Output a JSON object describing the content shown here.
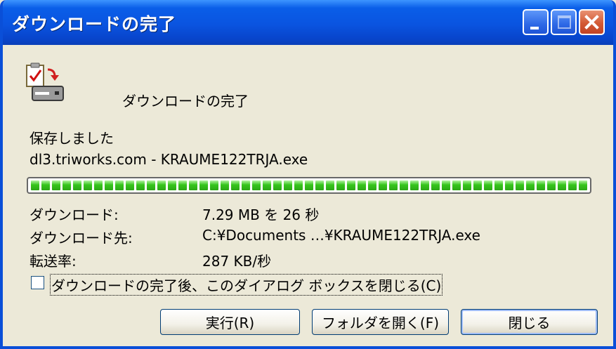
{
  "window": {
    "title": "ダウンロードの完了",
    "controls": {
      "minimize": "minimize",
      "maximize": "maximize",
      "close": "close"
    }
  },
  "dialog": {
    "heading": "ダウンロードの完了",
    "status": "保存しました",
    "file": "dl3.triworks.com - KRAUME122TRJA.exe",
    "progress": {
      "fraction": 1.0
    },
    "details": [
      {
        "label": "ダウンロード:",
        "value": "7.29 MB を 26 秒"
      },
      {
        "label": "ダウンロード先:",
        "value": "C:¥Documents …¥KRAUME122TRJA.exe"
      },
      {
        "label": "転送率:",
        "value": "287 KB/秒"
      }
    ],
    "close_when_done": {
      "label": "ダウンロードの完了後、このダイアログ ボックスを閉じる(C)",
      "checked": false
    },
    "buttons": {
      "run": "実行(R)",
      "open_folder": "フォルダを開く(F)",
      "close": "閉じる"
    }
  },
  "colors": {
    "titlebar": "#0a54e0",
    "face": "#ece9d8",
    "progress_fill": "#35c51c",
    "close_button": "#d35a34"
  },
  "icons": [
    "download-complete-icon",
    "minimize-icon",
    "maximize-icon",
    "close-icon"
  ]
}
